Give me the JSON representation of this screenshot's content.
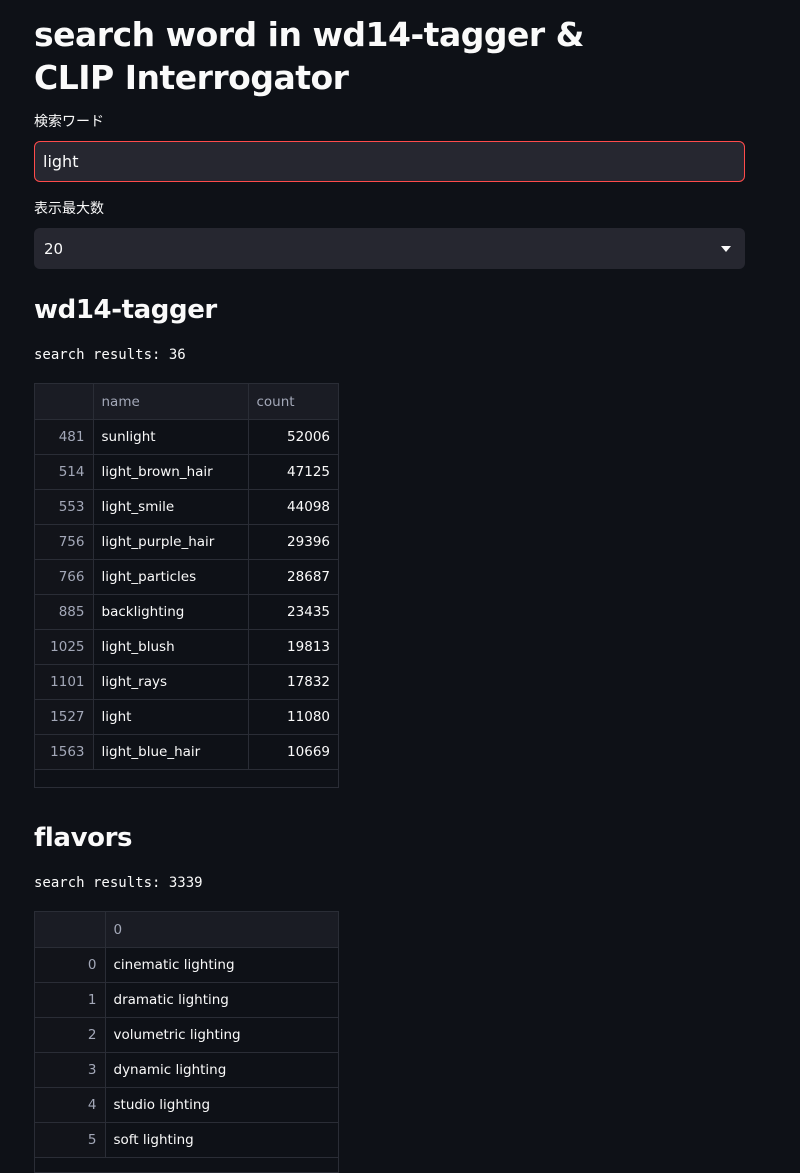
{
  "title": "search word in wd14-tagger & CLIP Interrogator",
  "search": {
    "label": "検索ワード",
    "value": "light"
  },
  "max_display": {
    "label": "表示最大数",
    "selected": "20"
  },
  "wd14": {
    "heading": "wd14-tagger",
    "result_text": "search results: 36",
    "columns": [
      "",
      "name",
      "count"
    ],
    "rows": [
      {
        "index": "481",
        "name": "sunlight",
        "count": "52006"
      },
      {
        "index": "514",
        "name": "light_brown_hair",
        "count": "47125"
      },
      {
        "index": "553",
        "name": "light_smile",
        "count": "44098"
      },
      {
        "index": "756",
        "name": "light_purple_hair",
        "count": "29396"
      },
      {
        "index": "766",
        "name": "light_particles",
        "count": "28687"
      },
      {
        "index": "885",
        "name": "backlighting",
        "count": "23435"
      },
      {
        "index": "1025",
        "name": "light_blush",
        "count": "19813"
      },
      {
        "index": "1101",
        "name": "light_rays",
        "count": "17832"
      },
      {
        "index": "1527",
        "name": "light",
        "count": "11080"
      },
      {
        "index": "1563",
        "name": "light_blue_hair",
        "count": "10669"
      }
    ]
  },
  "flavors": {
    "heading": "flavors",
    "result_text": "search results: 3339",
    "columns": [
      "",
      "0"
    ],
    "rows": [
      {
        "index": "0",
        "value": "cinematic lighting"
      },
      {
        "index": "1",
        "value": "dramatic lighting"
      },
      {
        "index": "2",
        "value": "volumetric lighting"
      },
      {
        "index": "3",
        "value": "dynamic lighting"
      },
      {
        "index": "4",
        "value": "studio lighting"
      },
      {
        "index": "5",
        "value": "soft lighting"
      }
    ]
  }
}
